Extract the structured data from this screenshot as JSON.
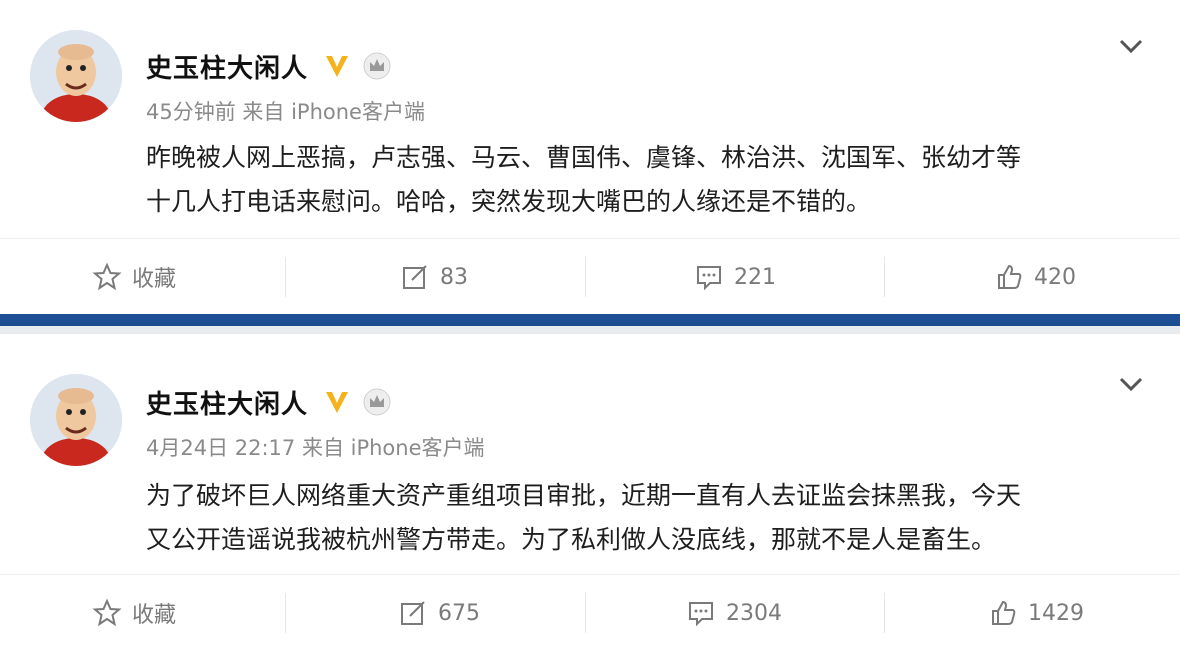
{
  "posts": [
    {
      "user": "史玉柱大闲人",
      "meta": "45分钟前 来自 iPhone客户端",
      "text_line1": "昨晚被人网上恶搞，卢志强、马云、曹国伟、虞锋、林治洪、沈国军、张幼才等",
      "text_line2": "十几人打电话来慰问。哈哈，突然发现大嘴巴的人缘还是不错的。",
      "actions": {
        "favorite": "收藏",
        "repost": "83",
        "comment": "221",
        "like": "420"
      }
    },
    {
      "user": "史玉柱大闲人",
      "meta": "4月24日 22:17 来自 iPhone客户端",
      "text_line1": "为了破坏巨人网络重大资产重组项目审批，近期一直有人去证监会抹黑我，今天",
      "text_line2": "又公开造谣说我被杭州警方带走。为了私利做人没底线，那就不是人是畜生。",
      "actions": {
        "favorite": "收藏",
        "repost": "675",
        "comment": "2304",
        "like": "1429"
      }
    }
  ],
  "colors": {
    "divider": "#1f4f96",
    "verified": "#f5b21b",
    "meta": "#8a8a8a",
    "actions": "#7a7a7a"
  },
  "icons": [
    "avatar",
    "verified-v-icon",
    "vip-crown-icon",
    "chevron-down-icon",
    "star-icon",
    "repost-icon",
    "comment-icon",
    "like-icon"
  ]
}
